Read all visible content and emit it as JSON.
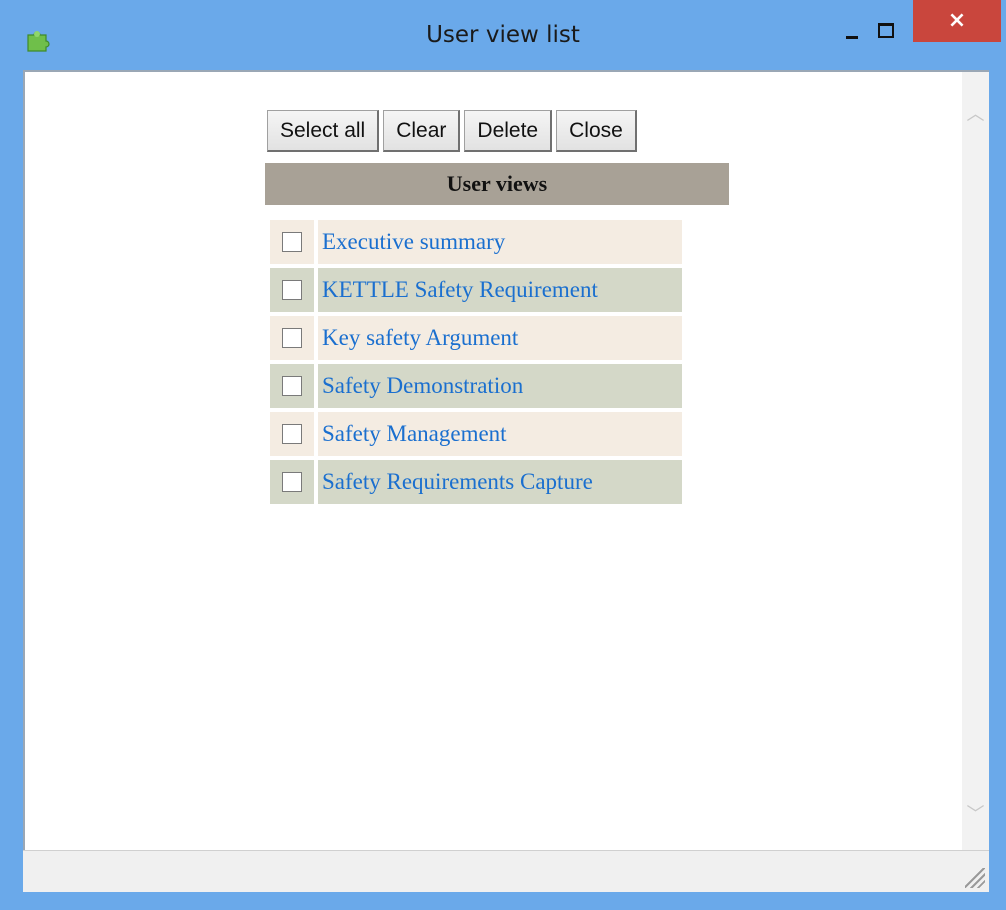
{
  "window": {
    "title": "User view list",
    "close_glyph": "×"
  },
  "toolbar": {
    "select_all_label": "Select all",
    "clear_label": "Clear",
    "delete_label": "Delete",
    "close_label": "Close"
  },
  "section": {
    "header": "User views"
  },
  "views": [
    {
      "label": "Executive summary",
      "checked": false
    },
    {
      "label": "KETTLE Safety Requirement",
      "checked": false
    },
    {
      "label": "Key safety Argument",
      "checked": false
    },
    {
      "label": "Safety Demonstration",
      "checked": false
    },
    {
      "label": "Safety Management",
      "checked": false
    },
    {
      "label": "Safety Requirements Capture",
      "checked": false
    }
  ],
  "icons": {
    "app": "puzzle-icon",
    "scroll_up": "chevron-up-icon",
    "scroll_down": "chevron-down-icon",
    "grip": "resize-grip-icon"
  },
  "colors": {
    "titlebar": "#6aa9ea",
    "close_button": "#c9463d",
    "header_bar": "#a8a196",
    "row_odd": "#f4ece2",
    "row_even": "#d4d8c8",
    "link": "#1a6fcf"
  }
}
